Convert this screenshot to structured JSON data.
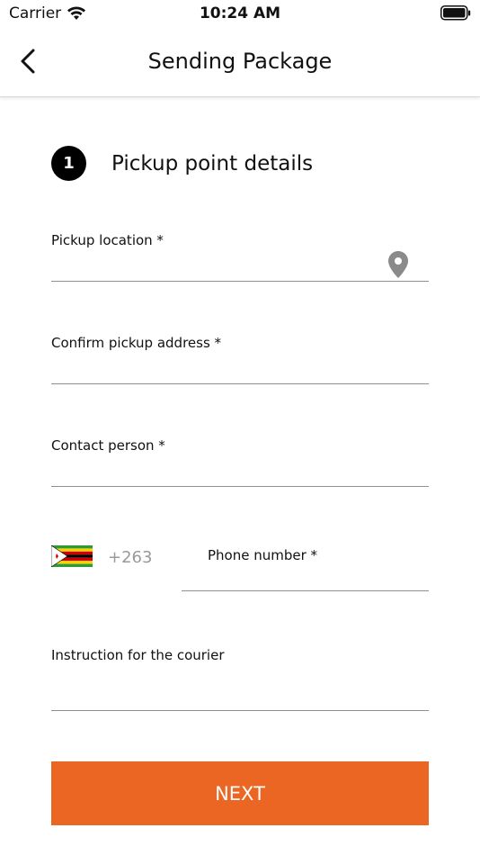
{
  "status_bar": {
    "carrier": "Carrier",
    "time": "10:24 AM"
  },
  "nav": {
    "title": "Sending Package",
    "back_icon": "chevron-left-icon"
  },
  "step": {
    "number": "1",
    "title": "Pickup point details"
  },
  "form": {
    "pickup_location": {
      "label": "Pickup location *",
      "value": "",
      "icon": "location-pin-icon"
    },
    "confirm_address": {
      "label": "Confirm pickup address *",
      "value": ""
    },
    "contact_person": {
      "label": "Contact person *",
      "value": ""
    },
    "phone": {
      "country_flag": "zimbabwe-flag-icon",
      "dial_code": "+263",
      "label": "Phone number *",
      "value": ""
    },
    "instruction": {
      "label": "Instruction for the courier",
      "value": ""
    }
  },
  "next_button": {
    "label": "NEXT"
  },
  "colors": {
    "accent": "#eb6623",
    "underline": "#8f8f8f",
    "placeholder": "#999999"
  }
}
